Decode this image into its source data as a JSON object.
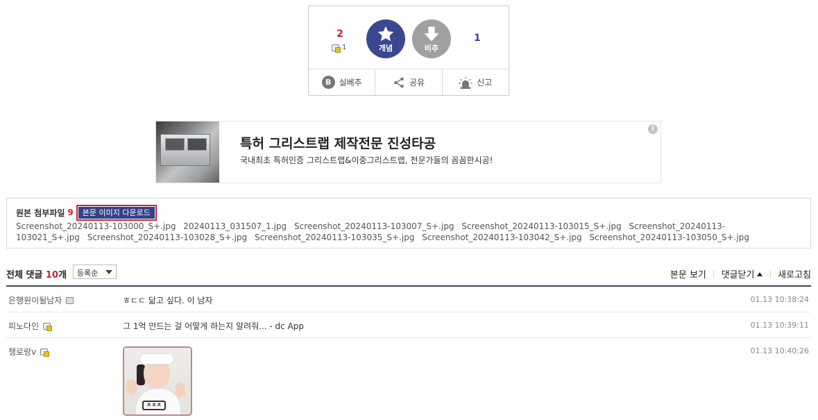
{
  "recommend": {
    "up_count": "2",
    "fix_count": "1",
    "up_label": "개념",
    "down_label": "비추",
    "down_count": "1",
    "actions": [
      "실베추",
      "공유",
      "신고"
    ],
    "b_letter": "B",
    "colors": {
      "up": "#3b4890",
      "down": "#a0a0a0",
      "count_red": "#c8232c"
    }
  },
  "ad": {
    "title": "특허 그리스트랩 제작전문 진성타공",
    "description": "국내최초 특허인증 그리스트랩&이중그리스트랩, 전문가들의 꼼꼼한시공!",
    "info_icon": "i"
  },
  "attachments": {
    "label": "원본 첨부파일",
    "count": "9",
    "download_label": "본문 이미지 다운로드",
    "files": [
      "Screenshot_20240113-103000_S+.jpg",
      "20240113_031507_1.jpg",
      "Screenshot_20240113-103007_S+.jpg",
      "Screenshot_20240113-103015_S+.jpg",
      "Screenshot_20240113-103021_S+.jpg",
      "Screenshot_20240113-103028_S+.jpg",
      "Screenshot_20240113-103035_S+.jpg",
      "Screenshot_20240113-103042_S+.jpg",
      "Screenshot_20240113-103050_S+.jpg"
    ]
  },
  "comments": {
    "title_prefix": "전체 댓글",
    "count_text": "10",
    "count_suffix": "개",
    "sort_label": "등록순",
    "view_post": "본문 보기",
    "close_comments": "댓글닫기",
    "refresh": "새로고침",
    "items": [
      {
        "nick": "은행원이될남자",
        "text": "ㅎㄷㄷ 닮고 싶다. 이 남자",
        "date": "01.13 10:38:24"
      },
      {
        "nick": "피노다인",
        "text": "그 1억 만드는 걸 어떻게 하는지 알려줘... - dc App",
        "date": "01.13 10:39:11"
      },
      {
        "nick": "챙로랑v",
        "text": "",
        "date": "01.13 10:40:26"
      }
    ]
  }
}
